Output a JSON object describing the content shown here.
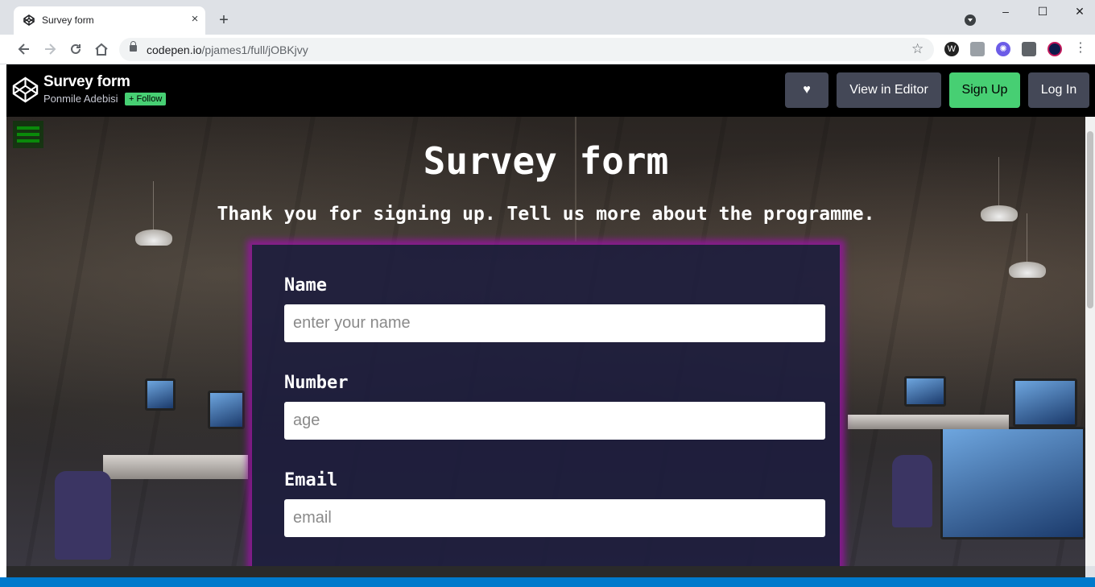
{
  "browser": {
    "tab_title": "Survey form",
    "tab_close": "×",
    "new_tab": "+",
    "window_controls": [
      "–",
      "☐",
      "✕"
    ],
    "url_host": "codepen.io",
    "url_path": "/pjames1/full/jOBKjvy",
    "nav_icons": [
      "back-arrow-icon",
      "forward-arrow-icon",
      "reload-icon",
      "home-icon"
    ],
    "extensions": [
      "wordpress-icon",
      "camera-icon",
      "gear-ext-icon",
      "puzzle-icon",
      "avatar-icon"
    ]
  },
  "codepen": {
    "title": "Survey form",
    "author": "Ponmile Adebisi",
    "follow_label": "Follow",
    "heart": "♥",
    "view_in_editor": "View in Editor",
    "sign_up": "Sign Up",
    "log_in": "Log In"
  },
  "page": {
    "heading": "Survey form",
    "description": "Thank you for signing up. Tell us more about the programme.",
    "fields": [
      {
        "label": "Name",
        "placeholder": "enter your name"
      },
      {
        "label": "Number",
        "placeholder": "age"
      },
      {
        "label": "Email",
        "placeholder": "email"
      }
    ]
  },
  "colors": {
    "codepen_green": "#47cf73",
    "form_glow": "#a020b0",
    "form_bg": "#1c1c3e",
    "status_bar": "#007acc"
  }
}
